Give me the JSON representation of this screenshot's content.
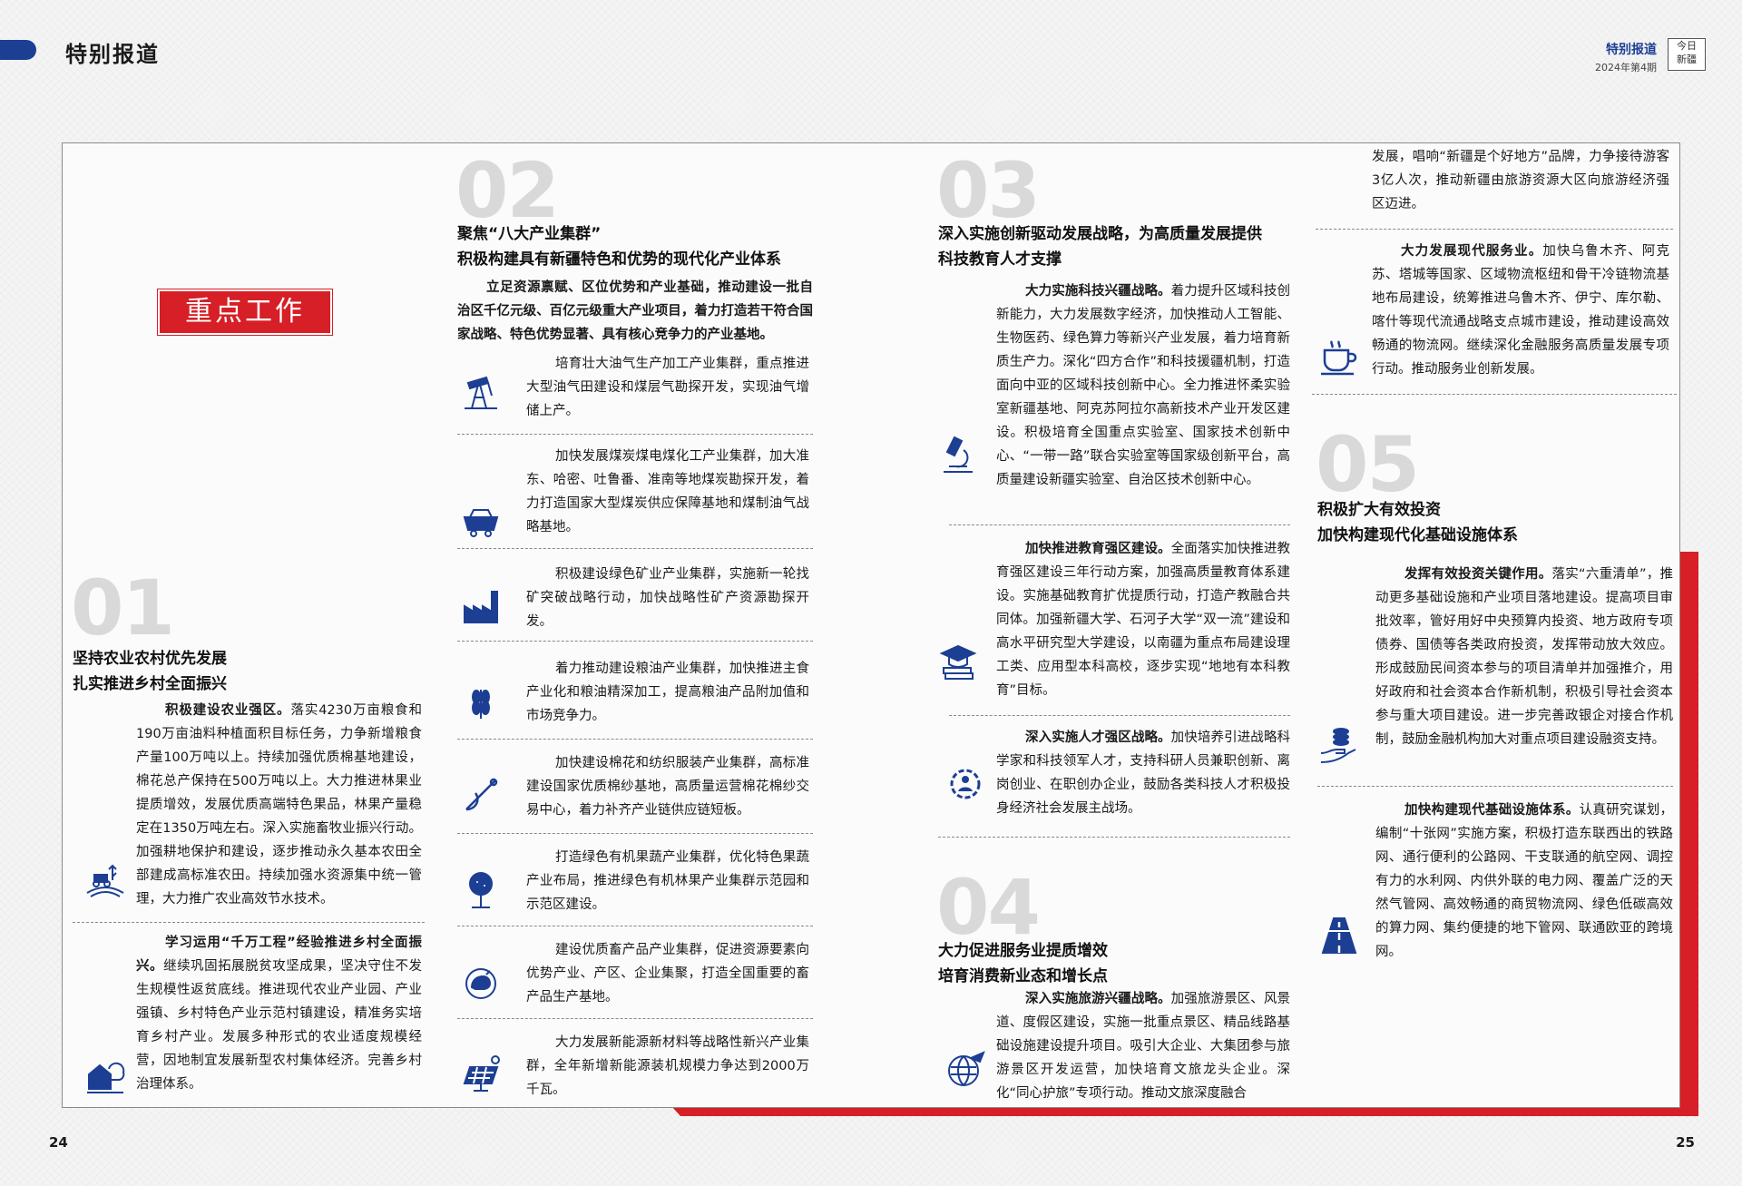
{
  "header": {
    "section_title": "特别报道",
    "right_title": "特别报道",
    "issue": "2024年第4期",
    "logo_text_1": "今日",
    "logo_text_2": "新疆"
  },
  "pages": {
    "left": "24",
    "right": "25"
  },
  "highlight": "重点工作",
  "s01": {
    "num": "01",
    "title1": "坚持农业农村优先发展",
    "title2": "扎实推进乡村全面振兴",
    "p1_lead": "积极建设农业强区。",
    "p1": "落实4230万亩粮食和190万亩油料种植面积目标任务，力争新增粮食产量100万吨以上。持续加强优质棉基地建设，棉花总产保持在500万吨以上。大力推进林果业提质增效，发展优质高端特色果品，林果产量稳定在1350万吨左右。深入实施畜牧业振兴行动。加强耕地保护和建设，逐步推动永久基本农田全部建成高标准农田。持续加强水资源集中统一管理，大力推广农业高效节水技术。",
    "p2_lead": "学习运用“千万工程”经验推进乡村全面振兴。",
    "p2": "继续巩固拓展脱贫攻坚成果，坚决守住不发生规模性返贫底线。推进现代农业产业园、产业强镇、乡村特色产业示范村镇建设，精准务实培育乡村产业。发展多种形式的农业适度规模经营，因地制宜发展新型农村集体经济。完善乡村治理体系。"
  },
  "s02": {
    "num": "02",
    "title1": "聚焦“八大产业集群”",
    "title2": "积极构建具有新疆特色和优势的现代化产业体系",
    "intro": "立足资源禀赋、区位优势和产业基础，推动建设一批自治区千亿元级、百亿元级重大产业项目，着力打造若干符合国家战略、特色优势显著、具有核心竞争力的产业基地。",
    "items": [
      "培育壮大油气生产加工产业集群，重点推进大型油气田建设和煤层气勘探开发，实现油气增储上产。",
      "加快发展煤炭煤电煤化工产业集群，加大准东、哈密、吐鲁番、准南等地煤炭勘探开发，着力打造国家大型煤炭供应保障基地和煤制油气战略基地。",
      "积极建设绿色矿业产业集群，实施新一轮找矿突破战略行动，加快战略性矿产资源勘探开发。",
      "着力推动建设粮油产业集群，加快推进主食产业化和粮油精深加工，提高粮油产品附加值和市场竞争力。",
      "加快建设棉花和纺织服装产业集群，高标准建设国家优质棉纱基地，高质量运营棉花棉纱交易中心，着力补齐产业链供应链短板。",
      "打造绿色有机果蔬产业集群，优化特色果蔬产业布局，推进绿色有机林果产业集群示范园和示范区建设。",
      "建设优质畜产品产业集群，促进资源要素向优势产业、产区、企业集聚，打造全国重要的畜产品生产基地。",
      "大力发展新能源新材料等战略性新兴产业集群，全年新增新能源装机规模力争达到2000万千瓦。"
    ]
  },
  "s03": {
    "num": "03",
    "title1": "深入实施创新驱动发展战略，为高质量发展提供",
    "title2": "科技教育人才支撑",
    "p1_lead": "大力实施科技兴疆战略。",
    "p1": "着力提升区域科技创新能力，大力发展数字经济，加快推动人工智能、生物医药、绿色算力等新兴产业发展，着力培育新质生产力。深化“四方合作”和科技援疆机制，打造面向中亚的区域科技创新中心。全力推进怀柔实验室新疆基地、阿克苏阿拉尔高新技术产业开发区建设。积极培育全国重点实验室、国家技术创新中心、“一带一路”联合实验室等国家级创新平台，高质量建设新疆实验室、自治区技术创新中心。",
    "p2_lead": "加快推进教育强区建设。",
    "p2": "全面落实加快推进教育强区建设三年行动方案，加强高质量教育体系建设。实施基础教育扩优提质行动，打造产教融合共同体。加强新疆大学、石河子大学“双一流”建设和高水平研究型大学建设，以南疆为重点布局建设理工类、应用型本科高校，逐步实现“地地有本科教育”目标。",
    "p3_lead": "深入实施人才强区战略。",
    "p3": "加快培养引进战略科学家和科技领军人才，支持科研人员兼职创新、离岗创业、在职创办企业，鼓励各类科技人才积极投身经济社会发展主战场。"
  },
  "s04": {
    "num": "04",
    "title1": "大力促进服务业提质增效",
    "title2": "培育消费新业态和增长点",
    "p1_lead": "深入实施旅游兴疆战略。",
    "p1": "加强旅游景区、风景道、度假区建设，实施一批重点景区、精品线路基础设施建设提升项目。吸引大企业、大集团参与旅游景区开发运营，加快培育文旅龙头企业。深化“同心护旅”专项行动。推动文旅深度融合",
    "p1_cont": "发展，唱响“新疆是个好地方”品牌，力争接待游客3亿人次，推动新疆由旅游资源大区向旅游经济强区迈进。",
    "p2_lead": "大力发展现代服务业。",
    "p2": "加快乌鲁木齐、阿克苏、塔城等国家、区域物流枢纽和骨干冷链物流基地布局建设，统筹推进乌鲁木齐、伊宁、库尔勒、喀什等现代流通战略支点城市建设，推动建设高效畅通的物流网。继续深化金融服务高质量发展专项行动。推动服务业创新发展。"
  },
  "s05": {
    "num": "05",
    "title1": "积极扩大有效投资",
    "title2": "加快构建现代化基础设施体系",
    "p1_lead": "发挥有效投资关键作用。",
    "p1": "落实“六重清单”，推动更多基础设施和产业项目落地建设。提高项目审批效率，管好用好中央预算内投资、地方政府专项债券、国债等各类政府投资，发挥带动放大效应。形成鼓励民间资本参与的项目清单并加强推介，用好政府和社会资本合作新机制，积极引导社会资本参与重大项目建设。进一步完善政银企对接合作机制，鼓励金融机构加大对重点项目建设融资支持。",
    "p2_lead": "加快构建现代基础设施体系。",
    "p2": "认真研究谋划，编制“十张网”实施方案，积极打造东联西出的铁路网、通行便利的公路网、干支联通的航空网、调控有力的水利网、内供外联的电力网、覆盖广泛的天然气管网、高效畅通的商贸物流网、绿色低碳高效的算力网、集约便捷的地下管网、联通欧亚的跨境网。"
  }
}
